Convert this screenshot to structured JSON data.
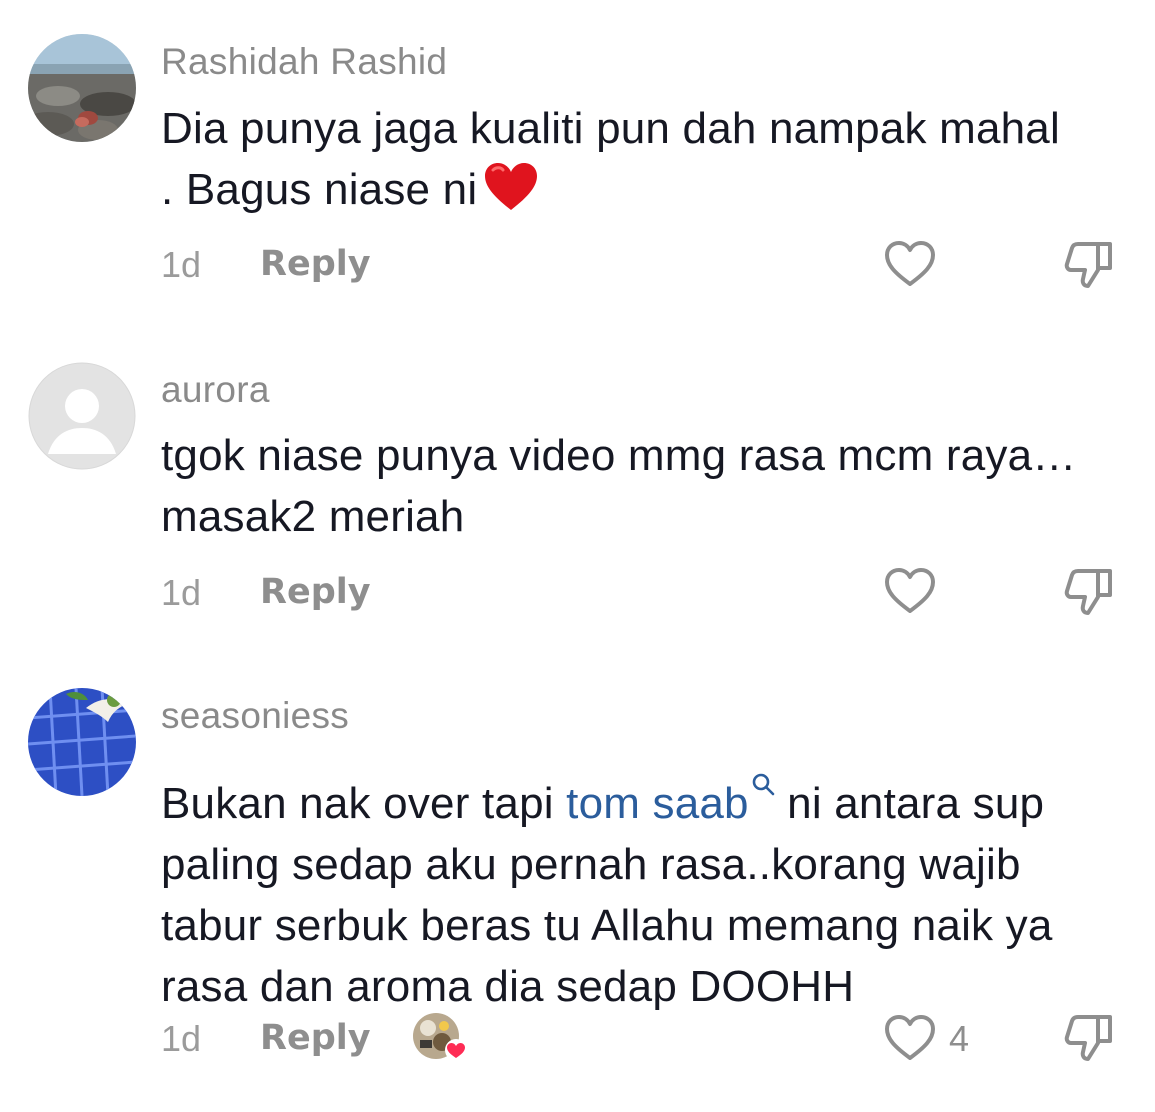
{
  "comments": [
    {
      "username": "Rashidah Rashid",
      "text": "Dia punya jaga kualiti pun dah nampak mahal . Bagus niase ni",
      "text_line1": "Dia punya jaga kualiti pun dah nampak mahal",
      "text_line2": ". Bagus niase ni",
      "emoji": "red-heart-emoji",
      "age": "1d",
      "reply_label": "Reply",
      "like_count": "",
      "avatar": "beach-photo-avatar"
    },
    {
      "username": "aurora",
      "text_line1": "tgok niase punya video mmg rasa mcm raya…",
      "text_line2": "masak2 meriah",
      "age": "1d",
      "reply_label": "Reply",
      "like_count": "",
      "avatar": "default-user-avatar"
    },
    {
      "username": "seasoniess",
      "text_before_mention": "Bukan nak over tapi ",
      "mention": "tom saab",
      "text_after_mention": " ni antara sup",
      "text_line2": "paling sedap aku pernah rasa..korang wajib",
      "text_line3": "tabur serbuk beras tu Allahu memang naik ya",
      "text_line4": "rasa dan aroma dia sedap DOOHH",
      "age": "1d",
      "reply_label": "Reply",
      "like_count": "4",
      "avatar": "blue-tile-avatar",
      "liked_by_creator": true
    }
  ],
  "colors": {
    "username": "#8a8a8a",
    "text": "#161823",
    "mention": "#2b5d9c",
    "meta": "#9b9b9b",
    "icon": "#8e8e8e",
    "heart_emoji": "#e0141e"
  }
}
